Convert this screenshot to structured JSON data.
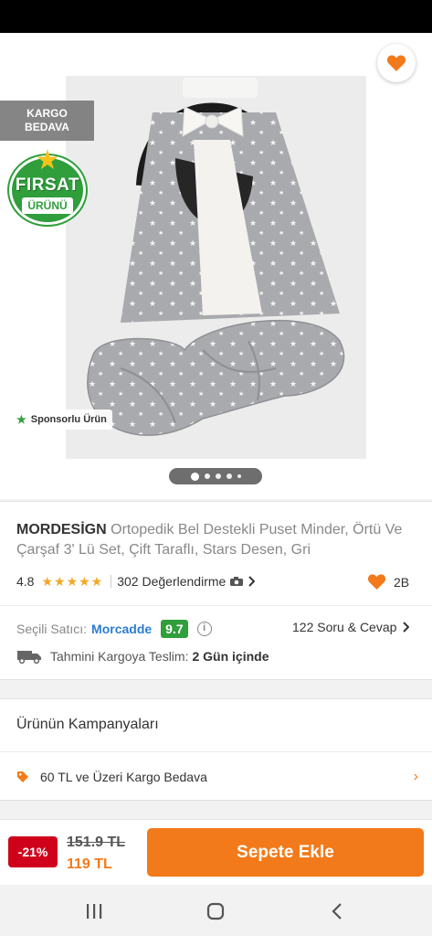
{
  "header": {
    "back_icon": "arrow-left-icon",
    "share_icon": "share-icon",
    "favorite_icon": "heart-icon"
  },
  "hero": {
    "kargo_badge_line1": "KARGO",
    "kargo_badge_line2": "BEDAVA",
    "firsat_line1": "FIRSAT",
    "firsat_line2": "ÜRÜNÜ",
    "sponsored_label": "Sponsorlu Ürün",
    "carousel_dots": 5,
    "carousel_active": 0
  },
  "product": {
    "brand": "MORDESİGN",
    "name": " Ortopedik Bel Destekli Puset Minder, Örtü Ve Çarşaf 3' Lü Set, Çift Taraflı, Stars Desen, Gri",
    "rating": "4.8",
    "stars": "★★★★★",
    "reviews": "302 Değerlendirme",
    "likes": "2B"
  },
  "seller": {
    "label": "Seçili Satıcı:",
    "name": "Morcadde",
    "score": "9.7",
    "qa": "122 Soru & Cevap",
    "shipping_label": "Tahmini Kargoya Teslim:",
    "shipping_days": "2 Gün içinde"
  },
  "campaigns": {
    "title": "Ürünün Kampanyaları",
    "item": "60 TL ve Üzeri Kargo Bedava"
  },
  "buy": {
    "discount": "-21%",
    "old_price": "151.9 TL",
    "new_price": "119 TL",
    "add_to_cart": "Sepete Ekle"
  },
  "colors": {
    "accent": "#f27a1a",
    "seller_link": "#2b7cd3",
    "score_green": "#2f9e3b",
    "discount_red": "#d0021b"
  }
}
